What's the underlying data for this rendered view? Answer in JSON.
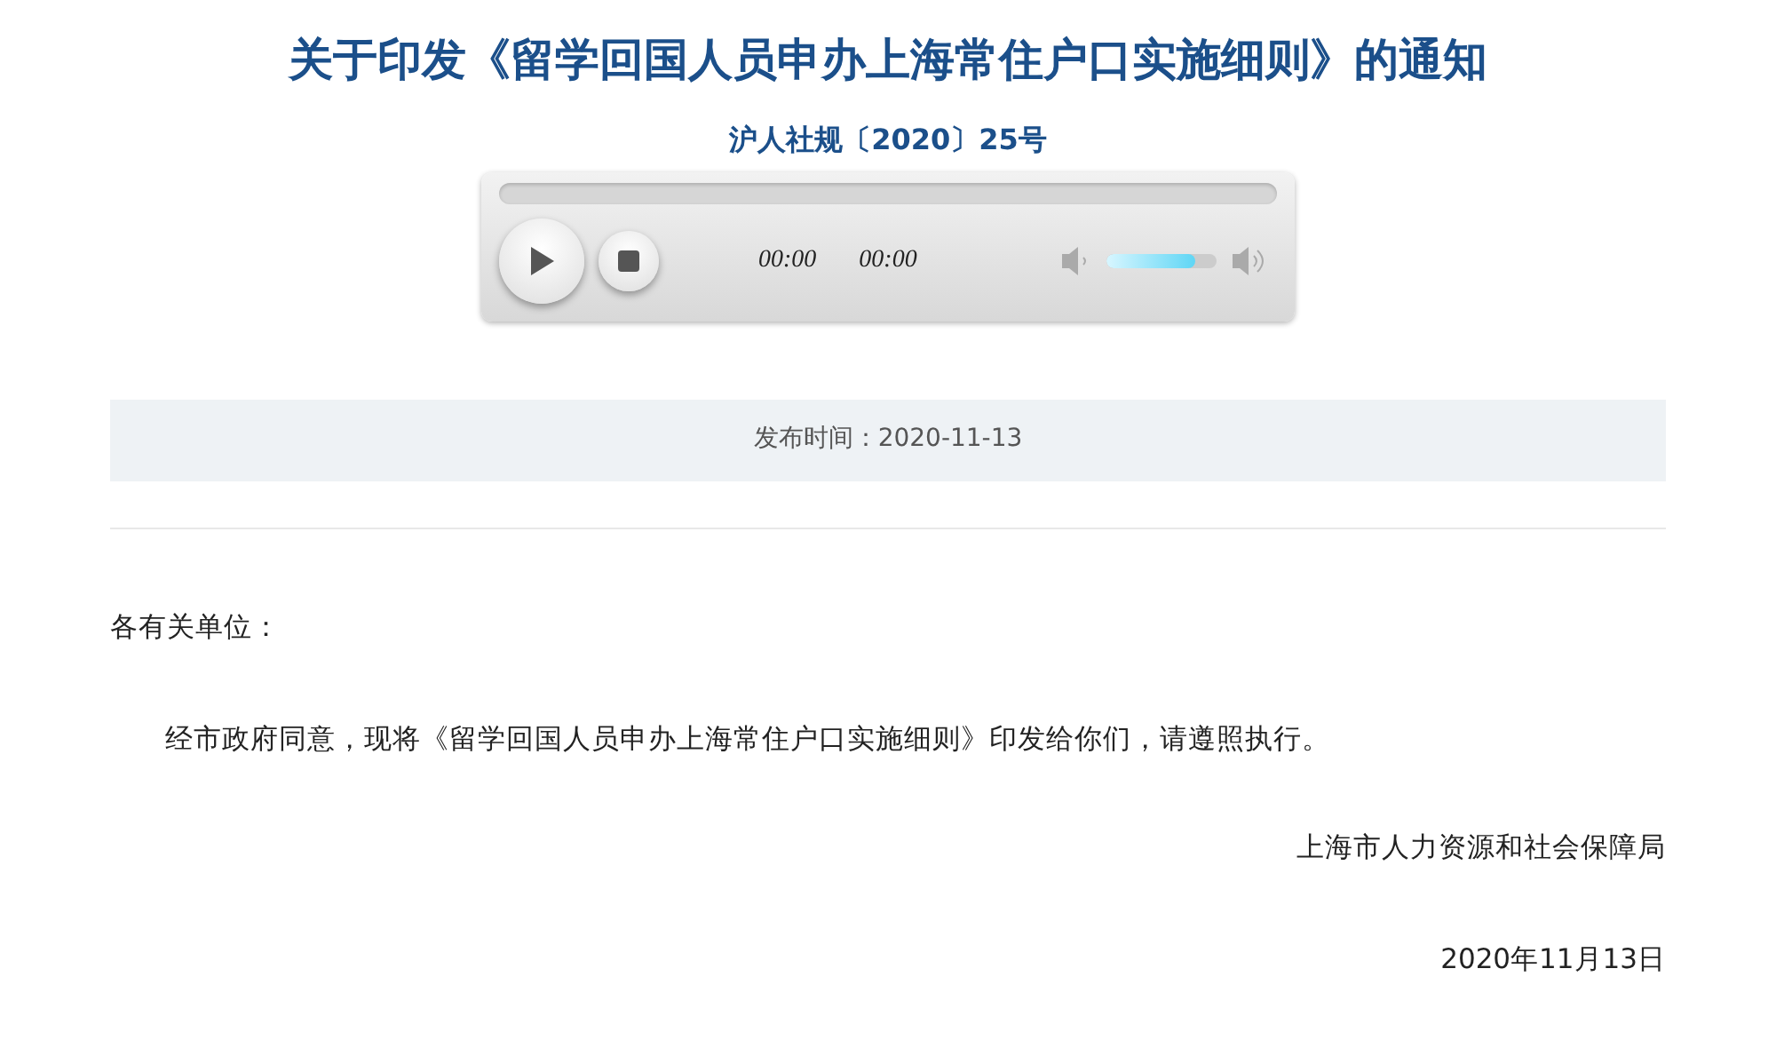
{
  "title": "关于印发《留学回国人员申办上海常住户口实施细则》的通知",
  "doc_number": "沪人社规〔2020〕25号",
  "audio_player": {
    "current_time": "00:00",
    "duration": "00:00",
    "volume": {
      "level": 0.8
    }
  },
  "publish_info": "发布时间：2020-11-13",
  "salutation": "各有关单位：",
  "paragraphs": [
    "经市政府同意，现将《留学回国人员申办上海常住户口实施细则》印发给你们，请遵照执行。"
  ],
  "issuer": "上海市人力资源和社会保障局",
  "date": "2020年11月13日"
}
